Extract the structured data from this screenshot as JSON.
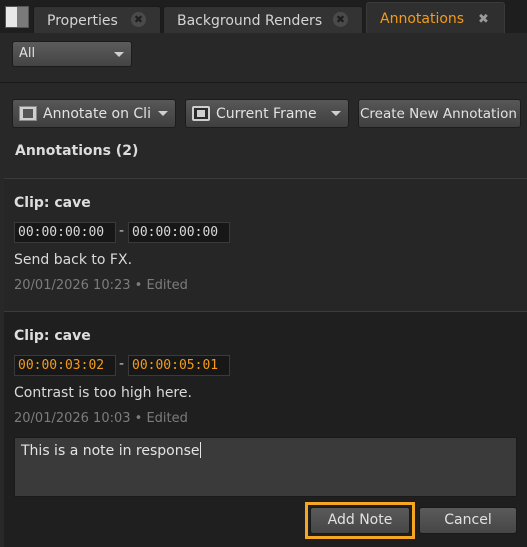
{
  "tabs": [
    {
      "label": "Properties",
      "active": false
    },
    {
      "label": "Background Renders",
      "active": false
    },
    {
      "label": "Annotations",
      "active": true
    }
  ],
  "tab_close_glyph": "✖",
  "filter": {
    "selected": "All"
  },
  "toolbar": {
    "annotate_on": "Annotate on Cli",
    "current_frame": "Current Frame",
    "create_new": "Create New Annotation"
  },
  "annotations_header": "Annotations (2)",
  "annotations": [
    {
      "clip": "Clip: cave",
      "tc_in": "00:00:00:00",
      "tc_out": "00:00:00:00",
      "note": "Send back to FX.",
      "meta": "20/01/2026 10:23 • Edited"
    },
    {
      "clip": "Clip: cave",
      "tc_in": "00:00:03:02",
      "tc_out": "00:00:05:01",
      "note": "Contrast is too high here.",
      "meta": "20/01/2026 10:03 • Edited",
      "reply_text": "This is a note in response"
    }
  ],
  "actions": {
    "add_note": "Add Note",
    "cancel": "Cancel"
  },
  "tc_separator": "-",
  "colors": {
    "accent": "#f39b1b",
    "highlight": "#f5a623",
    "panel": "#282828"
  },
  "icons": {
    "handle": "pane-handle-icon",
    "annotate": "film-clip-icon",
    "frame": "frame-icon",
    "caret": "chevron-down-icon",
    "close": "close-icon"
  }
}
